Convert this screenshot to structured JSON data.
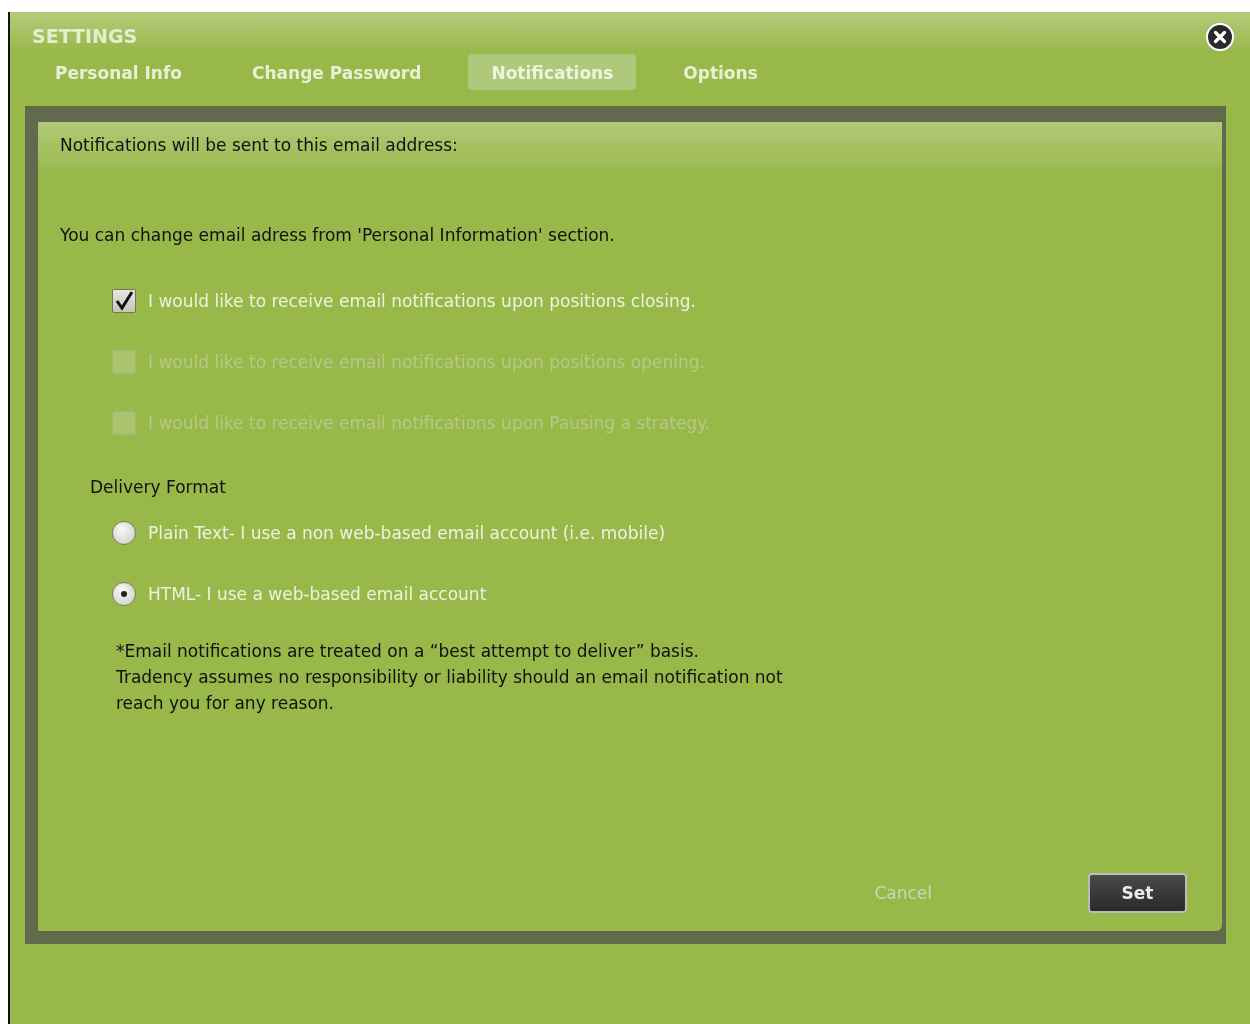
{
  "window": {
    "title": "SETTINGS"
  },
  "tabs": [
    {
      "label": "Personal Info",
      "selected": false
    },
    {
      "label": "Change Password",
      "selected": false
    },
    {
      "label": "Notifications",
      "selected": true
    },
    {
      "label": "Options",
      "selected": false
    }
  ],
  "header": "Notifications will be sent to this email address:",
  "info": "You can change email adress from 'Personal Information' section.",
  "checkboxes": [
    {
      "label": "I would like to receive email notifications upon positions closing.",
      "checked": true,
      "disabled": false
    },
    {
      "label": "I would like to receive email notifications upon positions opening.",
      "checked": false,
      "disabled": true
    },
    {
      "label": "I would like to receive email notifications upon Pausing a strategy.",
      "checked": false,
      "disabled": true
    }
  ],
  "delivery": {
    "title": "Delivery Format",
    "options": [
      {
        "label": "Plain Text- I use a non web-based email account (i.e. mobile)",
        "selected": false
      },
      {
        "label": "HTML- I use a web-based email account",
        "selected": true
      }
    ]
  },
  "disclaimer": [
    "*Email notifications are treated on a “best attempt to deliver” basis.",
    "Tradency assumes no responsibility or liability should an email notification not",
    "reach you for any reason."
  ],
  "buttons": {
    "cancel": "Cancel",
    "set": "Set"
  }
}
